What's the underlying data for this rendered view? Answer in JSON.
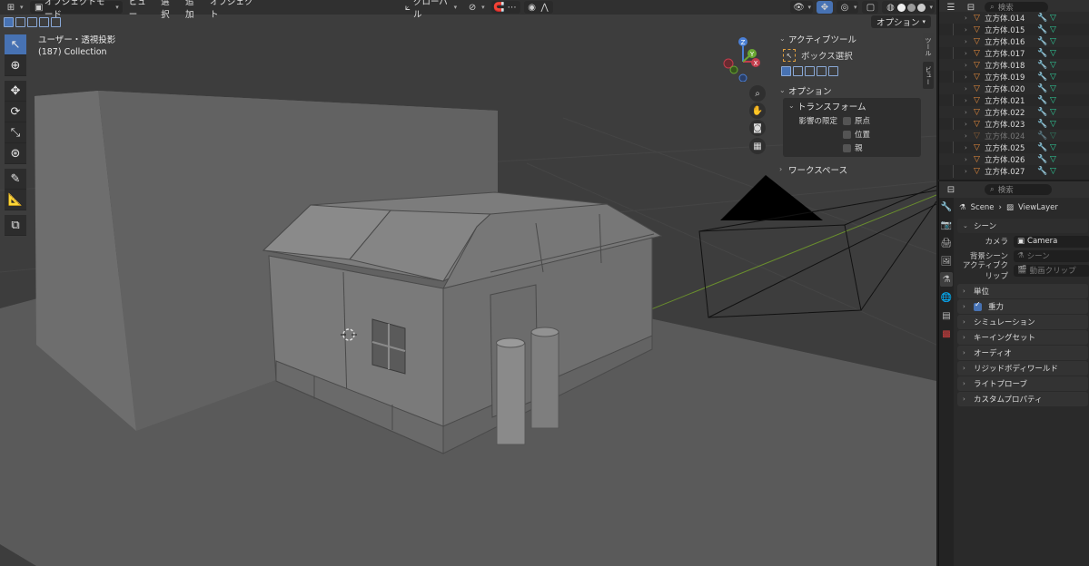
{
  "header": {
    "mode": "オブジェクトモード",
    "menus": [
      "ビュー",
      "選択",
      "追加",
      "オブジェクト"
    ],
    "orientation": "グローバル",
    "option": "オプション"
  },
  "viewport": {
    "view_name": "ユーザー・透視投影",
    "collection": "(187) Collection"
  },
  "gizmo": {
    "z": "Z",
    "x": "X",
    "y": "Y"
  },
  "npanel": {
    "active_tool": "アクティブツール",
    "tool_name": "ボックス選択",
    "options": "オプション",
    "transform": "トランスフォーム",
    "limit_label": "影響の限定",
    "limits": [
      {
        "label": "原点",
        "checked": false
      },
      {
        "label": "位置",
        "checked": false
      },
      {
        "label": "親",
        "checked": false
      }
    ],
    "workspace": "ワークスペース",
    "tabs": [
      "ツール",
      "ビュー"
    ]
  },
  "outliner": {
    "search_placeholder": "検索",
    "items": [
      {
        "name": "立方体.014",
        "dim": false
      },
      {
        "name": "立方体.015",
        "dim": false
      },
      {
        "name": "立方体.016",
        "dim": false
      },
      {
        "name": "立方体.017",
        "dim": false
      },
      {
        "name": "立方体.018",
        "dim": false
      },
      {
        "name": "立方体.019",
        "dim": false
      },
      {
        "name": "立方体.020",
        "dim": false
      },
      {
        "name": "立方体.021",
        "dim": false
      },
      {
        "name": "立方体.022",
        "dim": false
      },
      {
        "name": "立方体.023",
        "dim": false
      },
      {
        "name": "立方体.024",
        "dim": true
      },
      {
        "name": "立方体.025",
        "dim": false
      },
      {
        "name": "立方体.026",
        "dim": false
      },
      {
        "name": "立方体.027",
        "dim": false
      }
    ]
  },
  "properties": {
    "search_placeholder": "検索",
    "scene": "Scene",
    "view_layer": "ViewLayer",
    "scene_section": "シーン",
    "camera_label": "カメラ",
    "camera_value": "Camera",
    "bg_scene_label": "背景シーン",
    "bg_scene_value": "シーン",
    "active_clip_label": "アクティブクリップ",
    "active_clip_value": "動画クリップ",
    "sections": {
      "units": "単位",
      "gravity": "重力",
      "simulation": "シミュレーション",
      "keying": "キーイングセット",
      "audio": "オーディオ",
      "rigidbody": "リジッドボディワールド",
      "lightprobe": "ライトプローブ",
      "custom": "カスタムプロパティ"
    }
  },
  "colors": {
    "accent": "#4772b3",
    "object_orange": "#e88c3c",
    "mesh_green": "#2fcf9b",
    "modifier_blue": "#5a8fd6"
  }
}
